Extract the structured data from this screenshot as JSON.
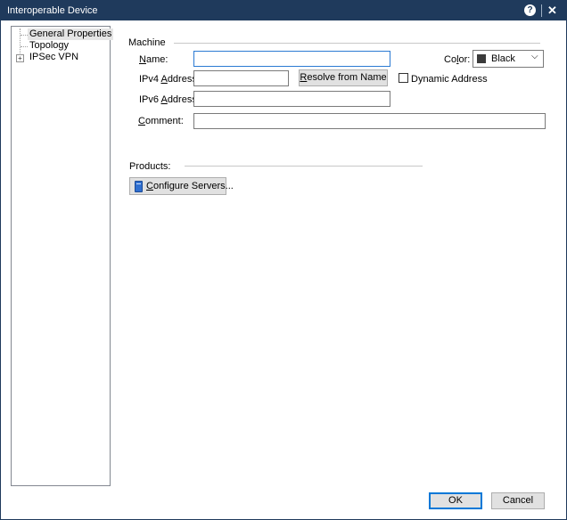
{
  "window": {
    "title": "Interoperable Device"
  },
  "tree": {
    "items": [
      {
        "label": "General Properties",
        "selected": true
      },
      {
        "label": "Topology",
        "selected": false
      },
      {
        "label": "IPSec VPN",
        "selected": false,
        "expandable": true
      }
    ]
  },
  "machine": {
    "section_label": "Machine",
    "name_label_pre": "",
    "name_label_key": "N",
    "name_label_post": "ame:",
    "name_value": "",
    "ipv4_label_pre": "IPv4 ",
    "ipv4_label_key": "A",
    "ipv4_label_post": "ddress:",
    "ipv4_value": "",
    "resolve_key": "R",
    "resolve_rest": "esolve from Name",
    "ipv6_label_pre": "IPv6 ",
    "ipv6_label_key": "A",
    "ipv6_label_post": "ddress:",
    "ipv6_value": "",
    "comment_label_key": "C",
    "comment_label_post": "omment:",
    "comment_value": "",
    "color_label_pre": "Co",
    "color_label_key": "l",
    "color_label_post": "or:",
    "color_value": "Black",
    "color_swatch": "#3a3a3a",
    "dynamic_address_label": "Dynamic Address",
    "dynamic_address_checked": false
  },
  "products": {
    "section_label": "Products:",
    "configure_key": "C",
    "configure_rest": "onfigure Servers..."
  },
  "footer": {
    "ok_label": "OK",
    "cancel_label": "Cancel"
  },
  "colors": {
    "titlebar": "#1f3a5c",
    "focus": "#2b7ad3",
    "default_button": "#0078d7"
  }
}
